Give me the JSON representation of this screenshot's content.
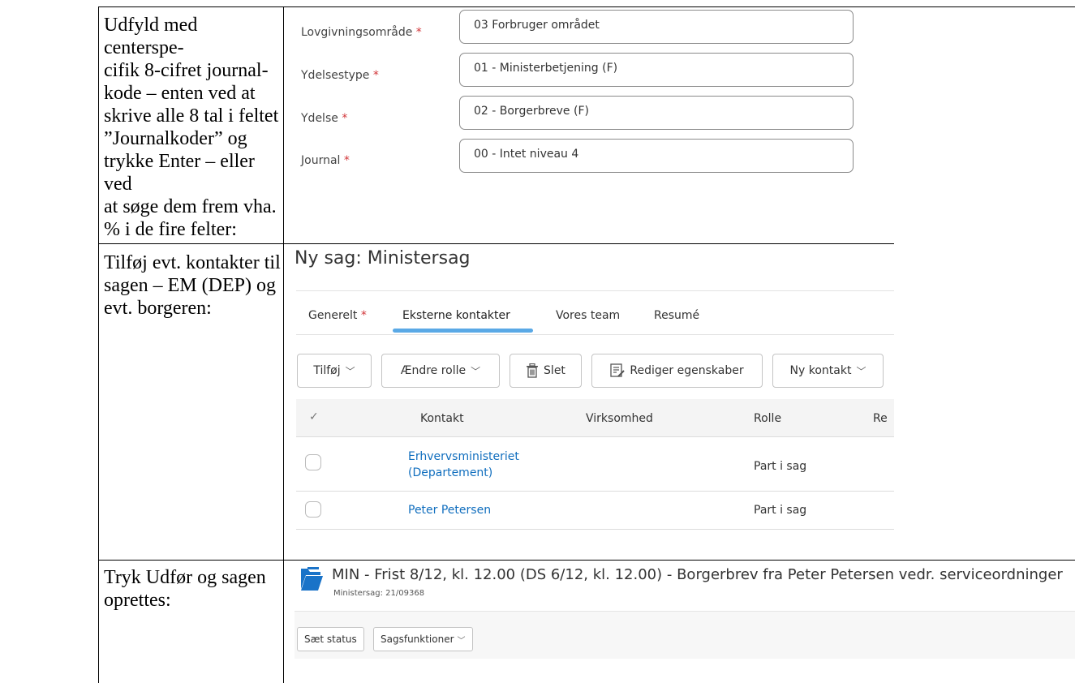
{
  "instructions": {
    "row1_lines": [
      "Udfyld med centerspe-",
      "cifik 8-cifret journal-",
      "kode – enten ved at",
      "skrive alle 8 tal i feltet",
      "”Journalkoder” og",
      "trykke Enter – eller ved",
      "at søge dem frem vha.",
      "% i de fire felter:"
    ],
    "row2_lines": [
      "Tilføj evt. kontakter til",
      "sagen – EM (DEP) og",
      "evt. borgeren:"
    ],
    "row3_lines": [
      "Tryk Udfør og sagen",
      "oprettes:"
    ]
  },
  "journal_form": {
    "required_marker": "*",
    "fields": [
      {
        "label": "Lovgivningsområde",
        "value": "03 Forbruger området"
      },
      {
        "label": "Ydelsestype",
        "value": "01 - Ministerbetjening (F)"
      },
      {
        "label": "Ydelse",
        "value": "02 - Borgerbreve (F)"
      },
      {
        "label": "Journal",
        "value": "00 - Intet niveau 4"
      }
    ]
  },
  "case_dialog": {
    "title": "Ny sag: Ministersag",
    "tabs": [
      {
        "label": "Generelt",
        "required": "*"
      },
      {
        "label": "Eksterne kontakter"
      },
      {
        "label": "Vores team"
      },
      {
        "label": "Resumé"
      }
    ],
    "toolbar": {
      "add": "Tilføj",
      "change_role": "Ændre rolle",
      "delete": "Slet",
      "edit_properties": "Rediger egenskaber",
      "new_contact": "Ny kontakt"
    },
    "table": {
      "check_header": "✓",
      "columns": [
        "Kontakt",
        "Virksomhed",
        "Rolle",
        "Re"
      ],
      "rows": [
        {
          "contact_line1": "Erhvervsministeriet",
          "contact_line2": "(Departement)",
          "company": "",
          "role": "Part i sag"
        },
        {
          "contact_line1": "Peter Petersen",
          "contact_line2": "",
          "company": "",
          "role": "Part i sag"
        }
      ]
    }
  },
  "case_header": {
    "title": "MIN - Frist 8/12, kl. 12.00 (DS 6/12, kl. 12.00) - Borgerbrev fra Peter Petersen vedr. serviceordninger",
    "subtitle": "Ministersag: 21/09368",
    "buttons": {
      "set_status": "Sæt status",
      "case_functions": "Sagsfunktioner"
    }
  },
  "colors": {
    "link": "#106ebe",
    "tab_indicator": "#5aa9e6",
    "required": "#d13438",
    "folder_icon": "#1a73c8"
  }
}
